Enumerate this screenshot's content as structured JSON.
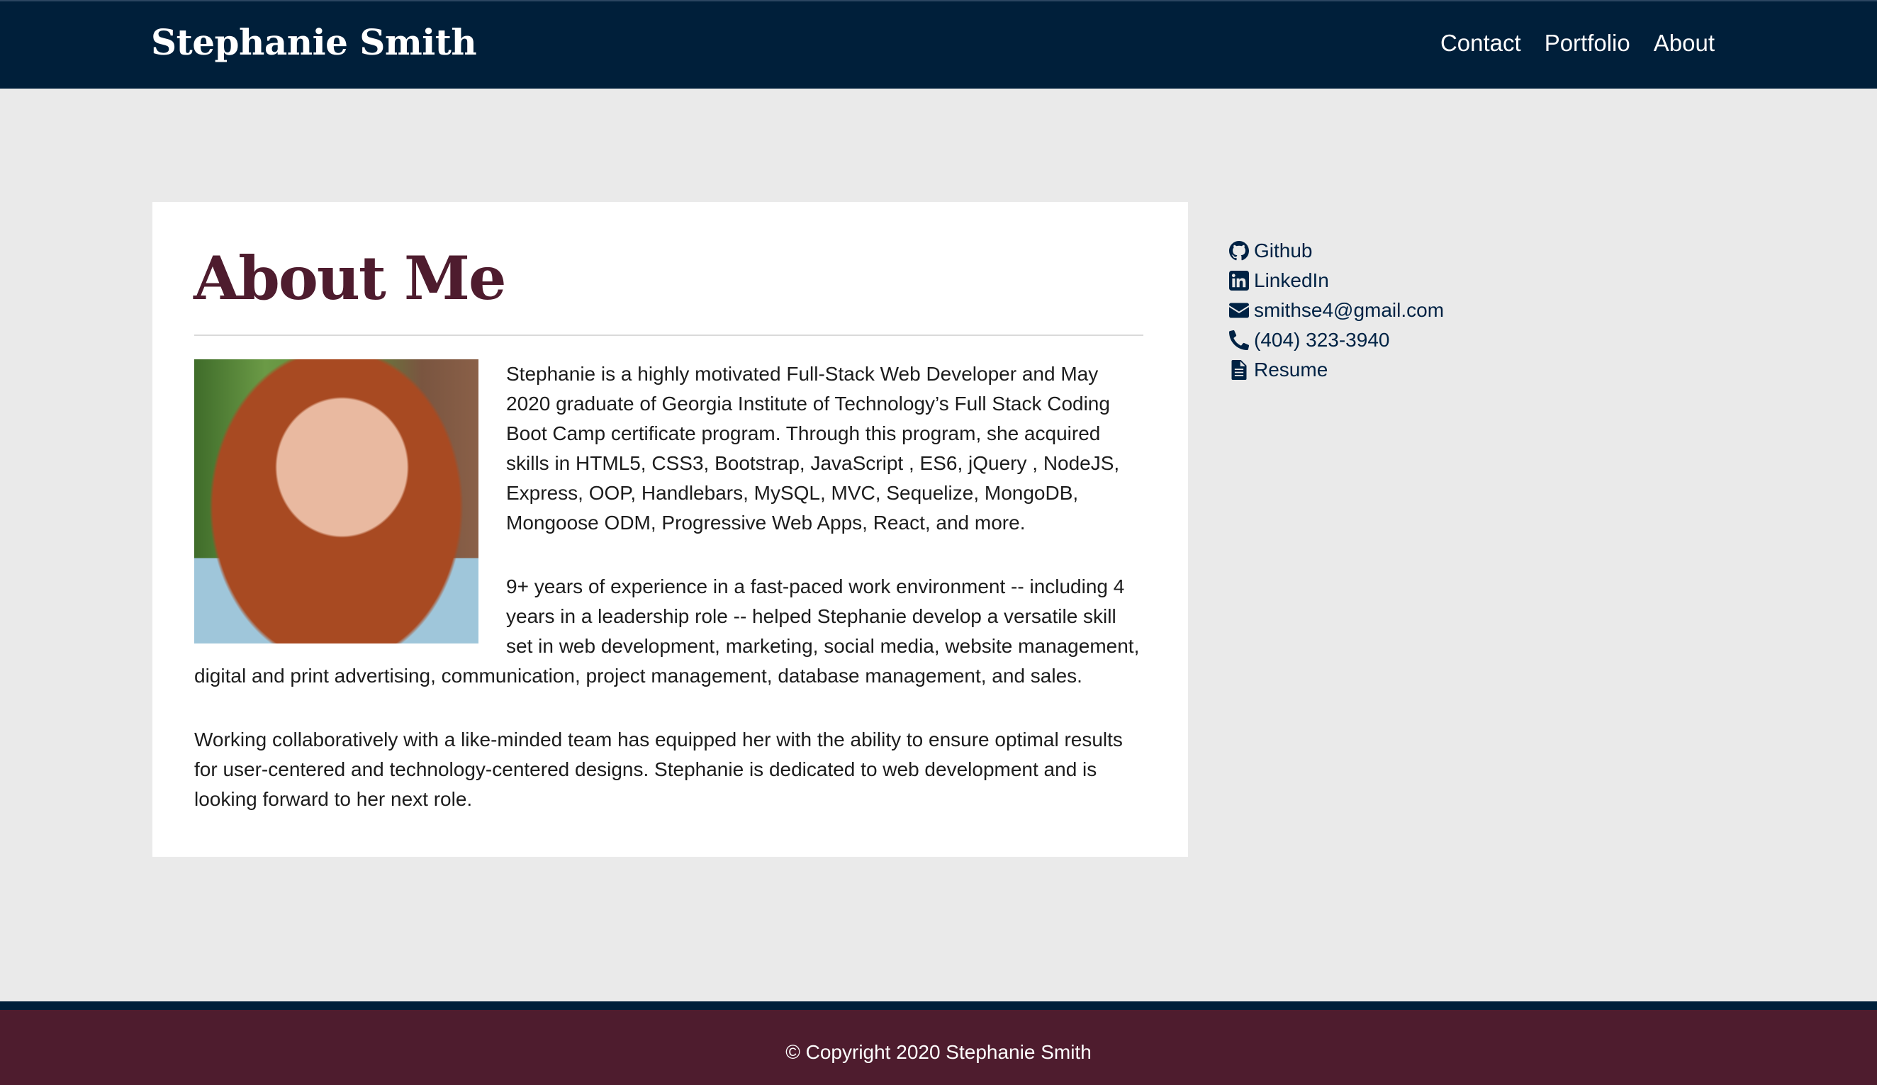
{
  "header": {
    "brand": "Stephanie Smith",
    "nav": [
      "Contact",
      "Portfolio",
      "About"
    ]
  },
  "main": {
    "title": "About Me",
    "photo_alt": "Portrait of Stephanie Smith",
    "paragraphs": [
      "Stephanie is a highly motivated Full-Stack Web Developer and May 2020 graduate of Georgia Institute of Technology’s Full Stack Coding Boot Camp certificate program. Through this program, she acquired skills in HTML5, CSS3, Bootstrap, JavaScript , ES6, jQuery , NodeJS, Express, OOP, Handlebars, MySQL, MVC, Sequelize, MongoDB, Mongoose ODM, Progressive Web Apps, React, and more.",
      "9+ years of experience in a fast-paced work environment -- including 4 years in a leadership role -- helped Stephanie develop a versatile skill set in web development, marketing, social media, website management, digital and print advertising, communication, project management, database management, and sales.",
      "Working collaboratively with a like-minded team has equipped her with the ability to ensure optimal results for user-centered and technology-centered designs. Stephanie is dedicated to web development and is looking forward to her next role."
    ]
  },
  "sidebar": {
    "links": [
      {
        "label": "Github",
        "icon": "github-icon"
      },
      {
        "label": "LinkedIn",
        "icon": "linkedin-icon"
      },
      {
        "label": "smithse4@gmail.com",
        "icon": "envelope-icon"
      },
      {
        "label": "(404) 323-3940",
        "icon": "phone-icon"
      },
      {
        "label": "Resume",
        "icon": "file-icon"
      }
    ]
  },
  "footer": {
    "copyright": "© Copyright 2020 Stephanie Smith"
  },
  "colors": {
    "navbar": "#001f3a",
    "page_background": "#eaeaea",
    "title": "#4e1c2e",
    "footer": "#4e1c2e",
    "link": "#002244"
  }
}
